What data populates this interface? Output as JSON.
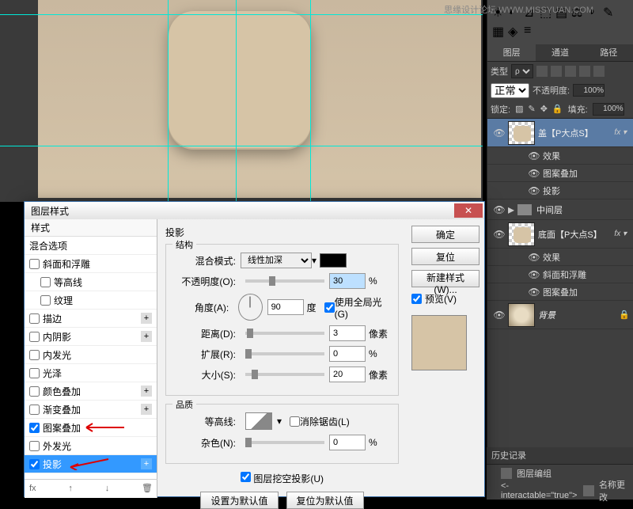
{
  "watermark": "思缘设计论坛  WWW.MISSYUAN.COM",
  "rightPanel": {
    "tabs": {
      "layers": "图层",
      "channels": "通道",
      "paths": "路径"
    },
    "typeLabel": "类型",
    "blendMode": "正常",
    "opacityLabel": "不透明度:",
    "opacityValue": "100%",
    "lockLabel": "锁定:",
    "fillLabel": "填充:",
    "fillValue": "100%",
    "layers": [
      {
        "name": "盖【P大点S】",
        "active": true,
        "fx": true
      },
      {
        "sub": true,
        "name": "效果"
      },
      {
        "sub": true,
        "name": "图案叠加"
      },
      {
        "sub": true,
        "name": "投影"
      },
      {
        "folder": true,
        "name": "中间层"
      },
      {
        "name": "底面【P大点S】",
        "fx": true
      },
      {
        "sub": true,
        "name": "效果"
      },
      {
        "sub": true,
        "name": "斜面和浮雕"
      },
      {
        "sub": true,
        "name": "图案叠加"
      },
      {
        "bg": true,
        "name": "背景"
      }
    ]
  },
  "history": {
    "title": "历史记录",
    "items": [
      "图层编组",
      "名称更改"
    ]
  },
  "dialog": {
    "title": "图层样式",
    "stylesHeader": "样式",
    "blendOptions": "混合选项",
    "styleList": [
      {
        "label": "斜面和浮雕",
        "checked": false
      },
      {
        "label": "等高线",
        "checked": false,
        "indent": true
      },
      {
        "label": "纹理",
        "checked": false,
        "indent": true
      },
      {
        "label": "描边",
        "checked": false,
        "plus": true
      },
      {
        "label": "内阴影",
        "checked": false,
        "plus": true
      },
      {
        "label": "内发光",
        "checked": false
      },
      {
        "label": "光泽",
        "checked": false
      },
      {
        "label": "颜色叠加",
        "checked": false,
        "plus": true
      },
      {
        "label": "渐变叠加",
        "checked": false,
        "plus": true
      },
      {
        "label": "图案叠加",
        "checked": true
      },
      {
        "label": "外发光",
        "checked": false
      },
      {
        "label": "投影",
        "checked": true,
        "selected": true,
        "plus": true
      }
    ],
    "footer": {
      "fx": "fx"
    },
    "shadow": {
      "title": "投影",
      "structure": "结构",
      "blendModeLabel": "混合模式:",
      "blendModeValue": "线性加深",
      "opacityLabel": "不透明度(O):",
      "opacityValue": "30",
      "opacityUnit": "%",
      "angleLabel": "角度(A):",
      "angleValue": "90",
      "angleUnit": "度",
      "useGlobalLight": "使用全局光(G)",
      "distanceLabel": "距离(D):",
      "distanceValue": "3",
      "distanceUnit": "像素",
      "spreadLabel": "扩展(R):",
      "spreadValue": "0",
      "spreadUnit": "%",
      "sizeLabel": "大小(S):",
      "sizeValue": "20",
      "sizeUnit": "像素",
      "quality": "品质",
      "contourLabel": "等高线:",
      "antiAlias": "消除锯齿(L)",
      "noiseLabel": "杂色(N):",
      "noiseValue": "0",
      "noiseUnit": "%",
      "knockout": "图层挖空投影(U)",
      "setDefault": "设置为默认值",
      "resetDefault": "复位为默认值"
    },
    "actions": {
      "ok": "确定",
      "cancel": "复位",
      "newStyle": "新建样式(W)...",
      "preview": "预览(V)"
    }
  }
}
